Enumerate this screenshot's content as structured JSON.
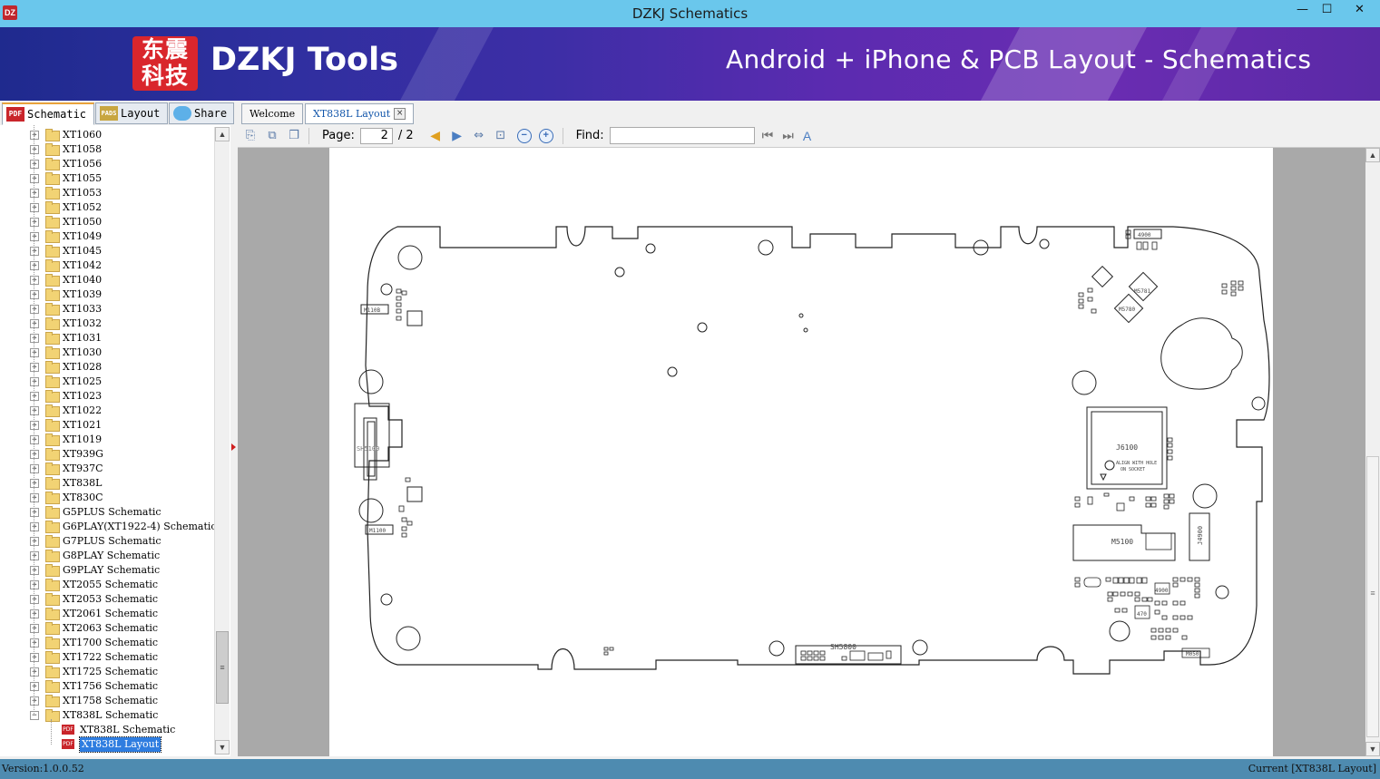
{
  "window": {
    "title": "DZKJ Schematics",
    "app_icon": "dzkj-app-icon",
    "minimize": "—",
    "maximize": "☐",
    "close": "✕"
  },
  "banner": {
    "logo_text_line1": "东震",
    "logo_text_line2": "科技",
    "brand": "DZKJ Tools",
    "tagline": "Android + iPhone & PCB Layout - Schematics"
  },
  "left_tabs": [
    {
      "label": "Schematic",
      "icon": "PDF"
    },
    {
      "label": "Layout",
      "icon": "PADS"
    },
    {
      "label": "Share",
      "icon": "cloud-share-icon"
    }
  ],
  "doc_tabs": [
    {
      "label": "Welcome"
    },
    {
      "label": "XT838L Layout"
    }
  ],
  "tree": {
    "items": [
      "XT1060",
      "XT1058",
      "XT1056",
      "XT1055",
      "XT1053",
      "XT1052",
      "XT1050",
      "XT1049",
      "XT1045",
      "XT1042",
      "XT1040",
      "XT1039",
      "XT1033",
      "XT1032",
      "XT1031",
      "XT1030",
      "XT1028",
      "XT1025",
      "XT1023",
      "XT1022",
      "XT1021",
      "XT1019",
      "XT939G",
      "XT937C",
      "XT838L",
      "XT830C",
      "G5PLUS Schematic",
      "G6PLAY(XT1922-4) Schematic",
      "G7PLUS Schematic",
      "G8PLAY Schematic",
      "G9PLAY Schematic",
      "XT2055 Schematic",
      "XT2053 Schematic",
      "XT2061 Schematic",
      "XT2063 Schematic",
      "XT1700 Schematic",
      "XT1722 Schematic",
      "XT1725 Schematic",
      "XT1756 Schematic",
      "XT1758 Schematic",
      "XT838L Schematic"
    ],
    "children": [
      {
        "label": "XT838L Schematic",
        "icon": "PDF"
      },
      {
        "label": "XT838L Layout",
        "icon": "PDF",
        "selected": true
      }
    ]
  },
  "toolbar": {
    "page_label": "Page:",
    "page_value": "2",
    "page_total": "/ 2",
    "find_label": "Find:",
    "find_value": ""
  },
  "pcb": {
    "labels": [
      "M110B",
      "SH5100",
      "M1100",
      "J6100",
      "ALIGN WITH HOLE",
      "ON SOCKET",
      "M5100",
      "J4900",
      "M5781",
      "M5780",
      "SH5800",
      "M1170",
      "M050",
      "4900",
      "470"
    ]
  },
  "status": {
    "version": "Version:1.0.0.52",
    "current": "Current [XT838L Layout]"
  },
  "colors": {
    "titlebar": "#6ac7ec",
    "statusbar": "#4e8bb0",
    "selection": "#2f7de0",
    "logo_red": "#d9262c"
  }
}
